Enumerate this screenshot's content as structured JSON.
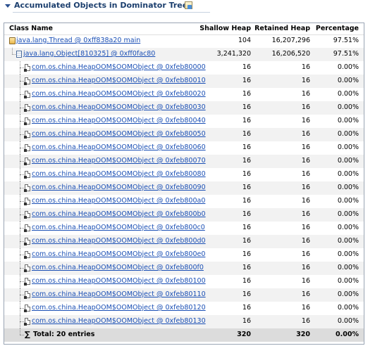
{
  "section": {
    "title": "Accumulated Objects in Dominator Tree"
  },
  "table": {
    "columns": {
      "name": "Class Name",
      "shallow": "Shallow Heap",
      "retained": "Retained Heap",
      "percentage": "Percentage"
    },
    "rows": [
      {
        "label": "java.lang.Thread @ 0xff838a20 main",
        "shallow": "104",
        "retained": "16,207,296",
        "percentage": "97.51%",
        "icon": "thread-icon",
        "level": 0
      },
      {
        "label": "java.lang.Object[810325] @ 0xff0fac80",
        "shallow": "3,241,320",
        "retained": "16,206,520",
        "percentage": "97.51%",
        "icon": "array-icon",
        "level": 1
      },
      {
        "label": "com.os.china.HeapOOM$OOMObject @ 0xfeb80000",
        "shallow": "16",
        "retained": "16",
        "percentage": "0.00%",
        "icon": "object-icon",
        "level": 2
      },
      {
        "label": "com.os.china.HeapOOM$OOMObject @ 0xfeb80010",
        "shallow": "16",
        "retained": "16",
        "percentage": "0.00%",
        "icon": "object-icon",
        "level": 2
      },
      {
        "label": "com.os.china.HeapOOM$OOMObject @ 0xfeb80020",
        "shallow": "16",
        "retained": "16",
        "percentage": "0.00%",
        "icon": "object-icon",
        "level": 2
      },
      {
        "label": "com.os.china.HeapOOM$OOMObject @ 0xfeb80030",
        "shallow": "16",
        "retained": "16",
        "percentage": "0.00%",
        "icon": "object-icon",
        "level": 2
      },
      {
        "label": "com.os.china.HeapOOM$OOMObject @ 0xfeb80040",
        "shallow": "16",
        "retained": "16",
        "percentage": "0.00%",
        "icon": "object-icon",
        "level": 2
      },
      {
        "label": "com.os.china.HeapOOM$OOMObject @ 0xfeb80050",
        "shallow": "16",
        "retained": "16",
        "percentage": "0.00%",
        "icon": "object-icon",
        "level": 2
      },
      {
        "label": "com.os.china.HeapOOM$OOMObject @ 0xfeb80060",
        "shallow": "16",
        "retained": "16",
        "percentage": "0.00%",
        "icon": "object-icon",
        "level": 2
      },
      {
        "label": "com.os.china.HeapOOM$OOMObject @ 0xfeb80070",
        "shallow": "16",
        "retained": "16",
        "percentage": "0.00%",
        "icon": "object-icon",
        "level": 2
      },
      {
        "label": "com.os.china.HeapOOM$OOMObject @ 0xfeb80080",
        "shallow": "16",
        "retained": "16",
        "percentage": "0.00%",
        "icon": "object-icon",
        "level": 2
      },
      {
        "label": "com.os.china.HeapOOM$OOMObject @ 0xfeb80090",
        "shallow": "16",
        "retained": "16",
        "percentage": "0.00%",
        "icon": "object-icon",
        "level": 2
      },
      {
        "label": "com.os.china.HeapOOM$OOMObject @ 0xfeb800a0",
        "shallow": "16",
        "retained": "16",
        "percentage": "0.00%",
        "icon": "object-icon",
        "level": 2
      },
      {
        "label": "com.os.china.HeapOOM$OOMObject @ 0xfeb800b0",
        "shallow": "16",
        "retained": "16",
        "percentage": "0.00%",
        "icon": "object-icon",
        "level": 2
      },
      {
        "label": "com.os.china.HeapOOM$OOMObject @ 0xfeb800c0",
        "shallow": "16",
        "retained": "16",
        "percentage": "0.00%",
        "icon": "object-icon",
        "level": 2
      },
      {
        "label": "com.os.china.HeapOOM$OOMObject @ 0xfeb800d0",
        "shallow": "16",
        "retained": "16",
        "percentage": "0.00%",
        "icon": "object-icon",
        "level": 2
      },
      {
        "label": "com.os.china.HeapOOM$OOMObject @ 0xfeb800e0",
        "shallow": "16",
        "retained": "16",
        "percentage": "0.00%",
        "icon": "object-icon",
        "level": 2
      },
      {
        "label": "com.os.china.HeapOOM$OOMObject @ 0xfeb800f0",
        "shallow": "16",
        "retained": "16",
        "percentage": "0.00%",
        "icon": "object-icon",
        "level": 2
      },
      {
        "label": "com.os.china.HeapOOM$OOMObject @ 0xfeb80100",
        "shallow": "16",
        "retained": "16",
        "percentage": "0.00%",
        "icon": "object-icon",
        "level": 2
      },
      {
        "label": "com.os.china.HeapOOM$OOMObject @ 0xfeb80110",
        "shallow": "16",
        "retained": "16",
        "percentage": "0.00%",
        "icon": "object-icon",
        "level": 2
      },
      {
        "label": "com.os.china.HeapOOM$OOMObject @ 0xfeb80120",
        "shallow": "16",
        "retained": "16",
        "percentage": "0.00%",
        "icon": "object-icon",
        "level": 2
      },
      {
        "label": "com.os.china.HeapOOM$OOMObject @ 0xfeb80130",
        "shallow": "16",
        "retained": "16",
        "percentage": "0.00%",
        "icon": "object-icon",
        "level": 2
      }
    ],
    "total": {
      "label": "Total: 20 entries",
      "shallow": "320",
      "retained": "320",
      "percentage": "0.00%",
      "icon": "sigma-icon"
    }
  },
  "colors": {
    "title": "#1c3f6e",
    "link": "#1a4fb5",
    "row_alt": "#f2f2f2",
    "total_row": "#dcdcdc"
  }
}
